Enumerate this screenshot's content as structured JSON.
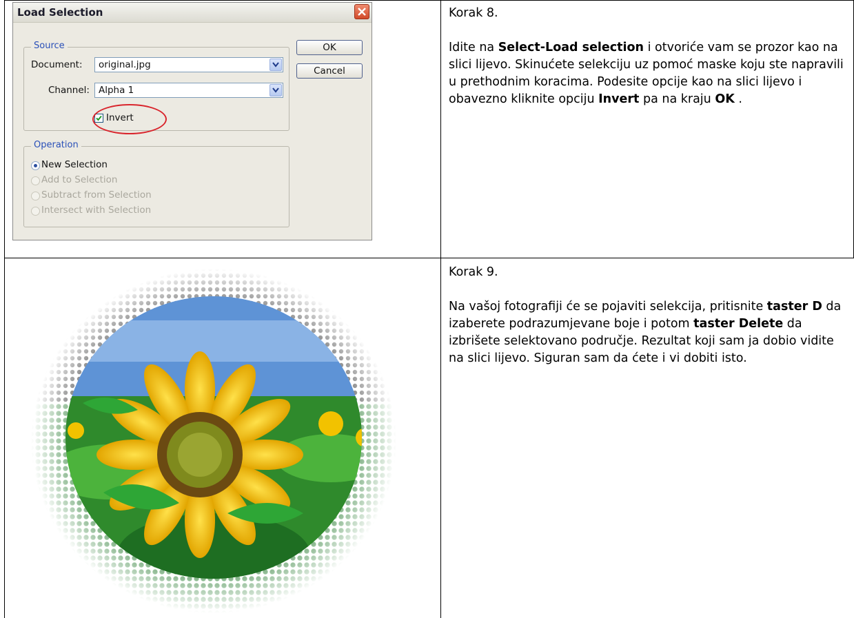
{
  "dialog": {
    "title": "Load Selection",
    "source_legend": "Source",
    "document_label": "Document:",
    "document_value": "original.jpg",
    "channel_label": "Channel:",
    "channel_value": "Alpha 1",
    "invert_label": "Invert",
    "invert_checked": true,
    "operation_legend": "Operation",
    "operations": [
      {
        "label": "New Selection",
        "selected": true,
        "enabled": true
      },
      {
        "label": "Add to Selection",
        "selected": false,
        "enabled": false
      },
      {
        "label": "Subtract from Selection",
        "selected": false,
        "enabled": false
      },
      {
        "label": "Intersect with Selection",
        "selected": false,
        "enabled": false
      }
    ],
    "ok_label": "OK",
    "cancel_label": "Cancel",
    "colors": {
      "highlight": "#d9242c",
      "legend": "#2a50b8",
      "background": "#eceae2"
    }
  },
  "step8": {
    "heading": "Korak 8.",
    "p1": "Idite na ",
    "b1": "Select-Load selection",
    "p2": " i otvoriće vam se prozor kao na slici lijevo. Skinućete selekciju uz pomoć maske koju ste napravili u prethodnim koracima. Podesite opcije kao na slici lijevo i obavezno kliknite opciju ",
    "b2": "Invert",
    "p3": " pa na kraju ",
    "b3": "OK",
    "p4": " ."
  },
  "step9": {
    "heading": "Korak 9.",
    "p1": "Na vašoj fotografiji će se pojaviti selekcija, pritisnite ",
    "b1": "taster D",
    "p2": " da izaberete podrazumjevane boje i potom ",
    "b2": "taster Delete",
    "p3": " da izbrišete selektovano područje. Rezultat koji sam ja dobio vidite na slici lijevo. Siguran sam da ćete i vi dobiti isto."
  }
}
